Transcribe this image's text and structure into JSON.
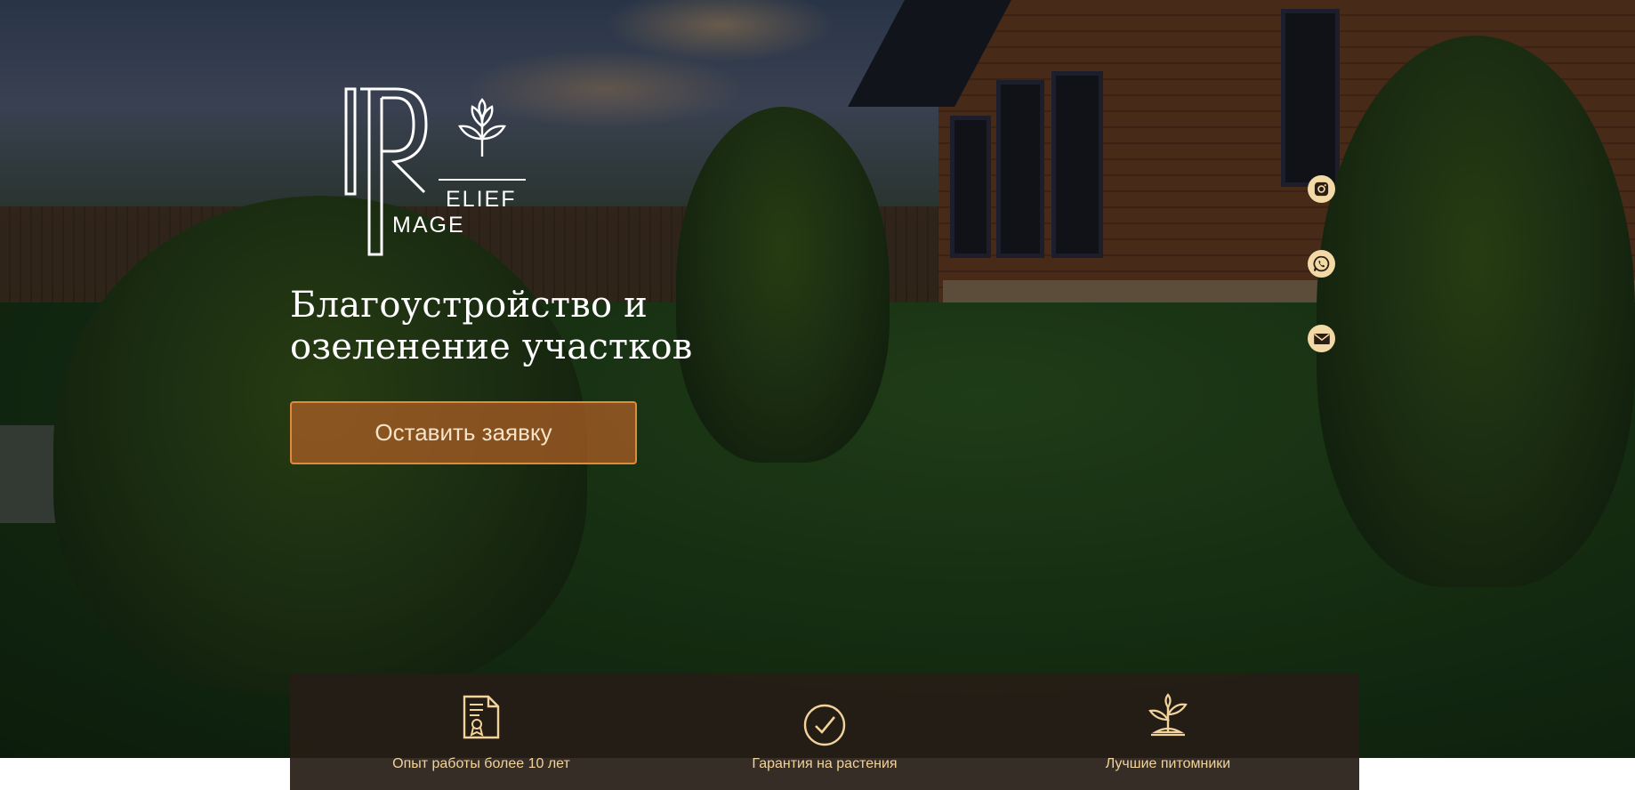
{
  "brand": {
    "logo_text": "ELIEF MAGE",
    "logo_line1": "ELIEF",
    "logo_line2": "MAGE"
  },
  "hero": {
    "headline": "Благоустройство и озеленение участков",
    "cta_label": "Оставить заявку"
  },
  "social": [
    {
      "icon": "instagram-icon"
    },
    {
      "icon": "whatsapp-icon"
    },
    {
      "icon": "mail-icon"
    }
  ],
  "features": [
    {
      "icon": "certificate-icon",
      "label": "Опыт работы более 10 лет"
    },
    {
      "icon": "check-circle-icon",
      "label": "Гарантия на растения"
    },
    {
      "icon": "sprout-icon",
      "label": "Лучшие питомники"
    }
  ],
  "colors": {
    "accent": "#e08a3a",
    "cta_bg": "#b26026",
    "feature_text": "#f2d39a",
    "social_bg": "#f2d9a6",
    "features_bg": "#261d16"
  }
}
